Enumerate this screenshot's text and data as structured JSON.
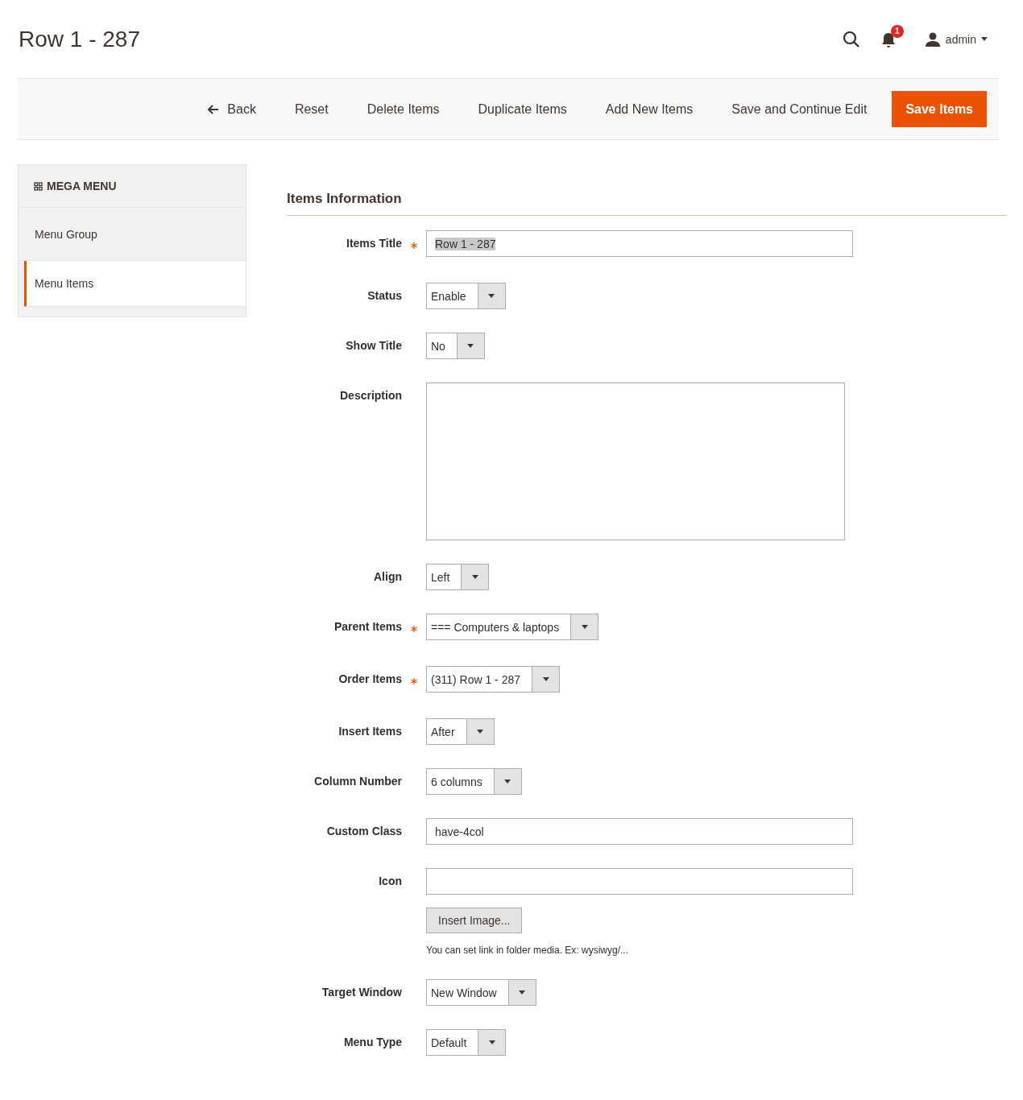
{
  "page_title": "Row 1 - 287",
  "header": {
    "notification_count": "1",
    "user": "admin"
  },
  "actions": [
    {
      "label": "Back",
      "kind": "back"
    },
    {
      "label": "Reset",
      "kind": "plain"
    },
    {
      "label": "Delete Items",
      "kind": "plain"
    },
    {
      "label": "Duplicate Items",
      "kind": "plain"
    },
    {
      "label": "Add New Items",
      "kind": "plain"
    },
    {
      "label": "Save and Continue Edit",
      "kind": "plain"
    },
    {
      "label": "Save Items",
      "kind": "primary"
    }
  ],
  "sidebar": {
    "title": "MEGA MENU",
    "items": [
      {
        "label": "Menu Group",
        "selected": false
      },
      {
        "label": "Menu Items",
        "selected": true
      }
    ]
  },
  "section_title": "Items Information",
  "fields": [
    {
      "label": "Items Title",
      "kind": "text",
      "required": true,
      "value": "Row 1 - 287",
      "text_selected": true
    },
    {
      "label": "Status",
      "kind": "select",
      "required": false,
      "value": "Enable"
    },
    {
      "label": "Show Title",
      "kind": "select",
      "required": false,
      "value": "No"
    },
    {
      "label": "Description",
      "kind": "textarea",
      "required": false
    },
    {
      "label": "Align",
      "kind": "select",
      "required": false,
      "value": "Left"
    },
    {
      "label": "Parent Items",
      "kind": "select",
      "required": true,
      "value": "=== Computers & laptops"
    },
    {
      "label": "Order Items",
      "kind": "select",
      "required": true,
      "value": "(311) Row 1 - 287"
    },
    {
      "label": "Insert Items",
      "kind": "select",
      "required": false,
      "value": "After"
    },
    {
      "label": "Column Number",
      "kind": "select",
      "required": false,
      "value": "6 columns"
    },
    {
      "label": "Custom Class",
      "kind": "text",
      "required": false,
      "value": "have-4col",
      "text_selected": false
    },
    {
      "label": "Icon",
      "kind": "image",
      "required": false,
      "button": "Insert Image...",
      "note": "You can set link in folder media. Ex: wysiwyg/..."
    },
    {
      "label": "Target Window",
      "kind": "select",
      "required": false,
      "value": "New Window"
    },
    {
      "label": "Menu Type",
      "kind": "select",
      "required": false,
      "value": "Default"
    }
  ]
}
